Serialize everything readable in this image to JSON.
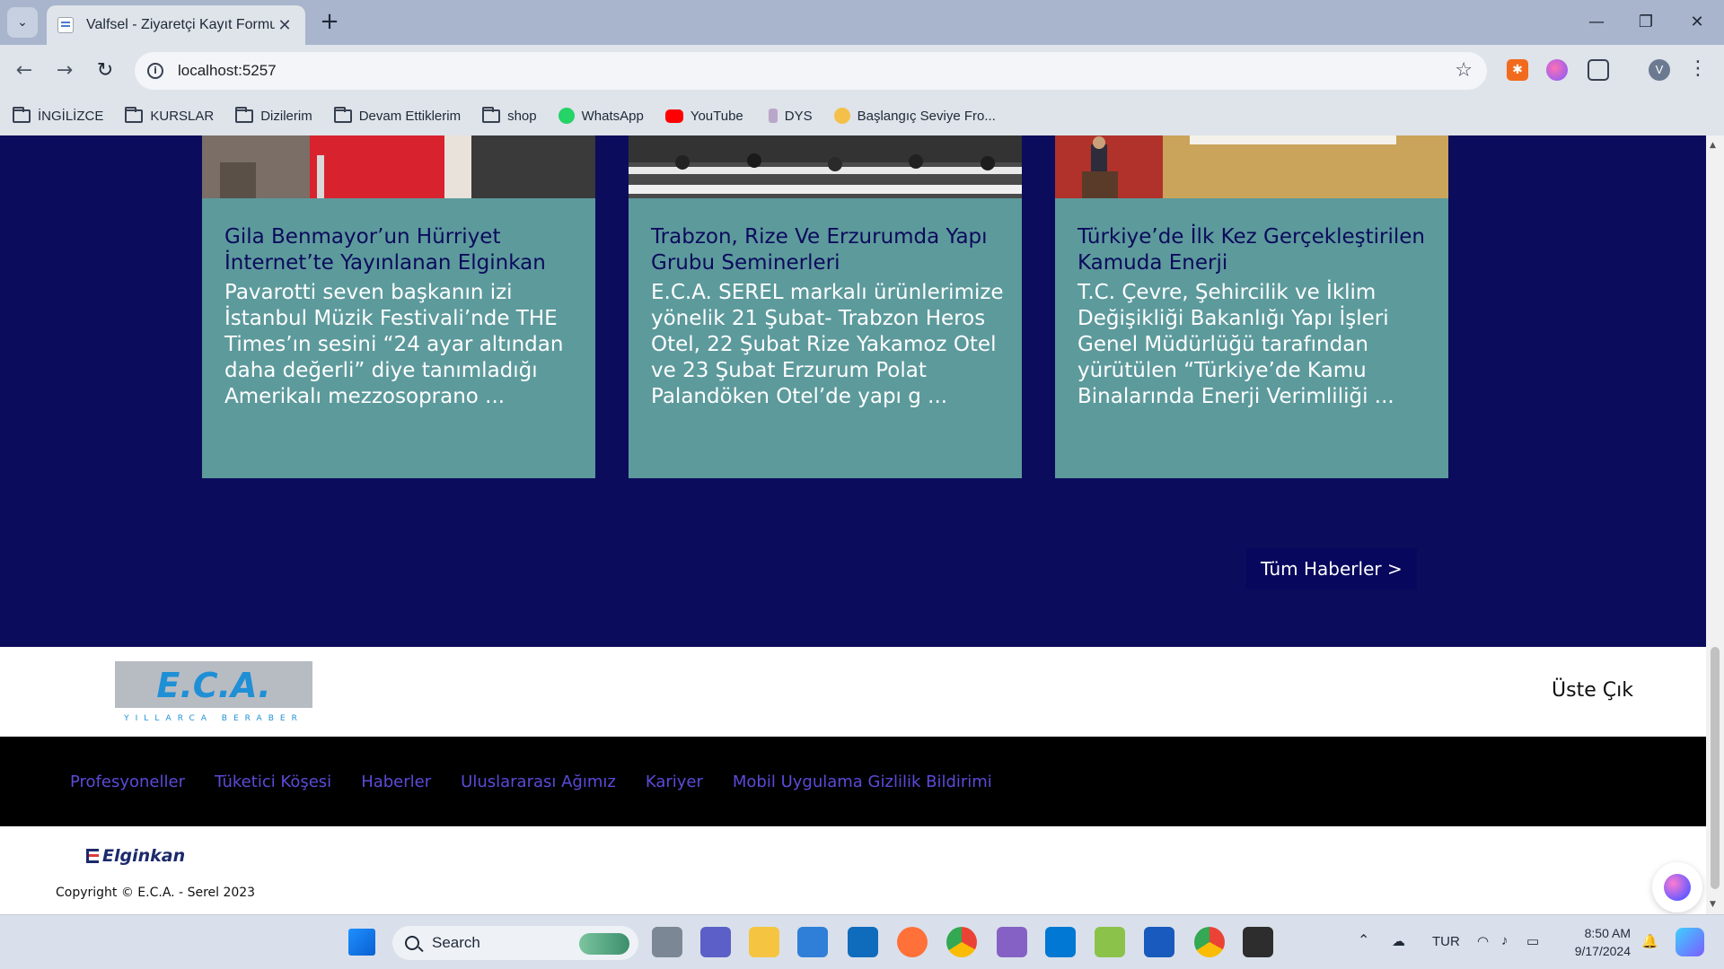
{
  "browser": {
    "tab": {
      "title": "Valfsel - Ziyaretçi Kayıt Formu",
      "close": "✕"
    },
    "new_tab": "+",
    "window_controls": {
      "minimize": "—",
      "maximize": "❐",
      "close": "✕"
    },
    "url": "localhost:5257",
    "profile_initial": "V",
    "bookmarks": [
      {
        "label": "İNGİLİZCE",
        "icon": "folder-icon"
      },
      {
        "label": "KURSLAR",
        "icon": "folder-icon"
      },
      {
        "label": "Dizilerim",
        "icon": "folder-icon"
      },
      {
        "label": "Devam Ettiklerim",
        "icon": "folder-icon"
      },
      {
        "label": "shop",
        "icon": "folder-icon"
      },
      {
        "label": "WhatsApp",
        "icon": "whatsapp-icon"
      },
      {
        "label": "YouTube",
        "icon": "youtube-icon"
      },
      {
        "label": "DYS",
        "icon": "dys-icon"
      },
      {
        "label": "Başlangıç Seviye Fro...",
        "icon": "circle-icon"
      }
    ]
  },
  "news": {
    "cards": [
      {
        "title": "Gila Benmayor’un Hürriyet İnternet’te Yayınlanan Elginkan",
        "excerpt": "Pavarotti seven başkanın izi İstanbul Müzik Festivali’nde THE Times’ın sesini “24 ayar altından daha değerli” diye tanımladığı Amerikalı mezzosoprano ..."
      },
      {
        "title": "Trabzon, Rize Ve Erzurumda Yapı Grubu Seminerleri",
        "excerpt": "E.C.A. SEREL markalı ürünlerimize yönelik 21 Şubat- Trabzon Heros Otel, 22 Şubat Rize Yakamoz Otel ve 23 Şubat Erzurum Polat Palandöken Otel’de yapı g ..."
      },
      {
        "title": "Türkiye’de İlk Kez Gerçekleştirilen Kamuda Enerji",
        "excerpt": "T.C. Çevre, Şehircilik ve İklim Değişikliği Bakanlığı Yapı İşleri Genel Müdürlüğü tarafından yürütülen “Türkiye’de Kamu Binalarında Enerji Verimliliği ..."
      }
    ],
    "all_news_button": "Tüm Haberler >"
  },
  "footer": {
    "logo_text": "E.C.A.",
    "logo_tagline": "YILLARCA BERABER",
    "back_to_top": "Üste Çık",
    "links": [
      "Profesyoneller",
      "Tüketici Köşesi",
      "Haberler",
      "Uluslararası Ağımız",
      "Kariyer",
      "Mobil Uygulama Gizlilik Bildirimi"
    ],
    "elginkan_logo": "Elginkan",
    "copyright": "Copyright © E.C.A. - Serel 2023"
  },
  "taskbar": {
    "search_placeholder": "Search",
    "language": "TUR",
    "time": "8:50 AM",
    "date": "9/17/2024"
  },
  "colors": {
    "news_bg": "#0c0c5c",
    "card_bg": "#5d9a9c",
    "card_title": "#0b0b5c",
    "footer_link": "#5a4bd8",
    "button_bg": "#07075e"
  }
}
